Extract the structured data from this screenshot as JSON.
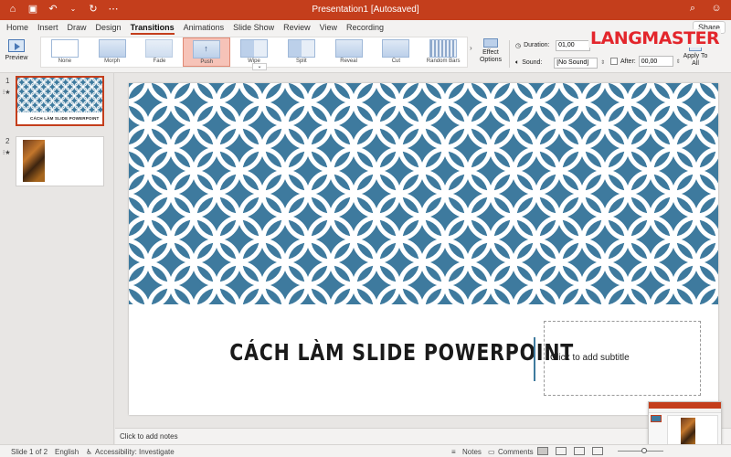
{
  "window": {
    "title": "Presentation1 [Autosaved]",
    "left_icons": [
      "home-icon",
      "save-icon",
      "undo-icon",
      "chevron-down-icon",
      "redo-icon",
      "more-icon"
    ],
    "right_icons": [
      "search-icon",
      "smile-icon"
    ]
  },
  "ribbon_tabs": [
    "Home",
    "Insert",
    "Draw",
    "Design",
    "Transitions",
    "Animations",
    "Slide Show",
    "Review",
    "View",
    "Recording"
  ],
  "active_tab": "Transitions",
  "share_label": "Share",
  "ribbon": {
    "preview_label": "Preview",
    "transitions": [
      "None",
      "Morph",
      "Fade",
      "Push",
      "Wipe",
      "Split",
      "Reveal",
      "Cut",
      "Random Bars"
    ],
    "selected_transition": "Push",
    "effect_options_label": "Effect Options",
    "duration_label": "Duration:",
    "duration_value": "01,00",
    "sound_label": "Sound:",
    "sound_value": "[No Sound]",
    "after_label": "After:",
    "after_value": "00,00",
    "apply_all_label": "Apply To All"
  },
  "watermark": "LANGMASTER",
  "slides_pane": [
    {
      "number": "1",
      "title": "CÁCH LÀM SLIDE POWERPOINT"
    },
    {
      "number": "2"
    }
  ],
  "slide": {
    "title": "CÁCH LÀM SLIDE POWERPOINT",
    "subtitle_placeholder": "Click to add subtitle"
  },
  "notes_placeholder": "Click to add notes",
  "status_bar": {
    "slide_info": "Slide 1 of 2",
    "language": "English",
    "accessibility": "Accessibility: Investigate",
    "notes_label": "Notes",
    "comments_label": "Comments"
  },
  "colors": {
    "accent": "#c43e1c",
    "pattern": "#3e7a9e",
    "watermark": "#e3262c"
  }
}
